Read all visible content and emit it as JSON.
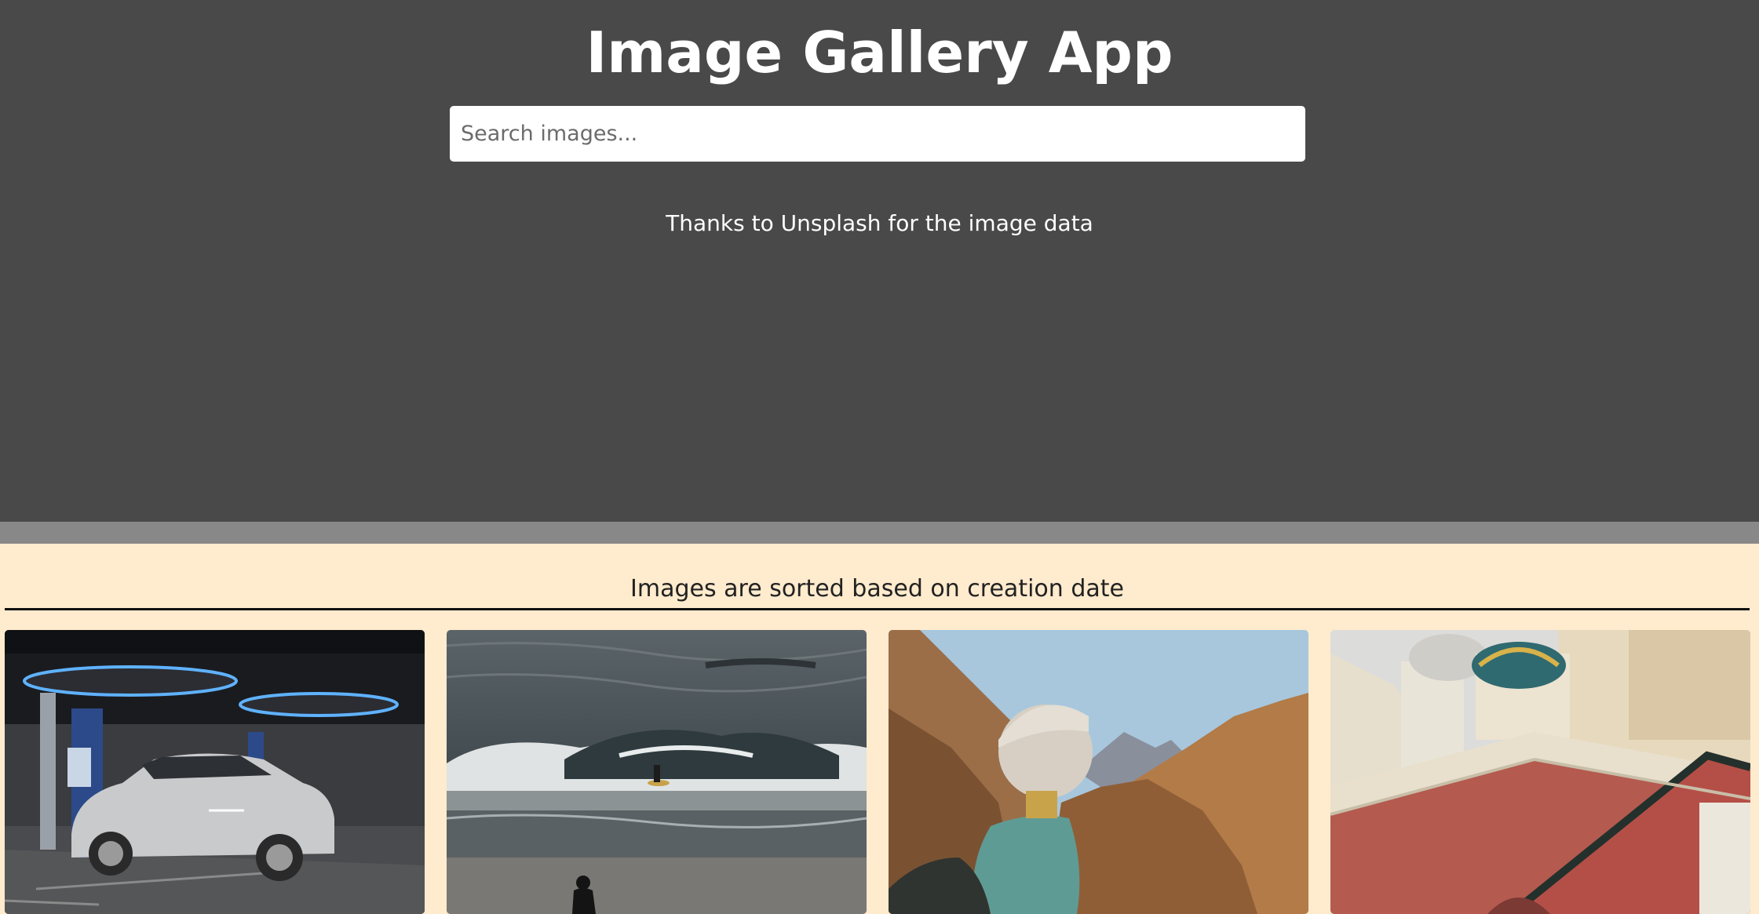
{
  "app": {
    "title": "Image Gallery App"
  },
  "search": {
    "placeholder": "Search images...",
    "value": ""
  },
  "credit": "Thanks to Unsplash for the image data",
  "sort_note": "Images are sorted based on creation date",
  "gallery": {
    "images": [
      {
        "subject": "white electric SUV at charging station"
      },
      {
        "subject": "surfer on ocean wave with person on beach"
      },
      {
        "subject": "hiker with hat facing desert mountains"
      },
      {
        "subject": "ornate church facade with domes"
      }
    ]
  },
  "colors": {
    "header_bg": "#494949",
    "divider": "#888888",
    "content_bg": "#ffebcd"
  }
}
